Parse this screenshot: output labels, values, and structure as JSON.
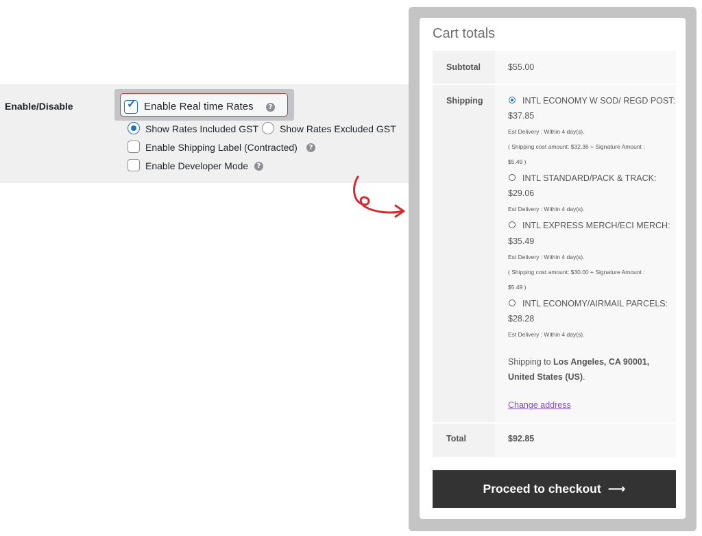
{
  "settings": {
    "section_label": "Enable/Disable",
    "realtime_rates": {
      "label": "Enable Real time Rates",
      "checked": true
    },
    "rates_gst": {
      "included_label": "Show Rates Included GST",
      "excluded_label": "Show Rates Excluded GST",
      "selected": "included"
    },
    "shipping_label": {
      "label": "Enable Shipping Label (Contracted)",
      "checked": false
    },
    "developer_mode": {
      "label": "Enable Developer Mode",
      "checked": false
    },
    "help_glyph": "?"
  },
  "cart": {
    "title": "Cart totals",
    "subtotal_label": "Subtotal",
    "subtotal_value": "$55.00",
    "shipping_label": "Shipping",
    "options": [
      {
        "name": "INTL ECONOMY W SOD/ REGD POST:",
        "price": "$37.85",
        "delivery": "Est Delivery : Within 4 day(s).",
        "cost_line1": "( Shipping cost amount: $32.36 + Signature Amount :",
        "cost_line2": "$5.49 )",
        "selected": true
      },
      {
        "name": "INTL STANDARD/PACK & TRACK:",
        "price": "$29.06",
        "delivery": "Est Delivery : Within 4 day(s).",
        "selected": false
      },
      {
        "name": "INTL EXPRESS MERCH/ECI MERCH:",
        "price": "$35.49",
        "delivery": "Est Delivery : Within 4 day(s).",
        "cost_line1": "( Shipping cost amount: $30.00 + Signature Amount :",
        "cost_line2": "$5.49 )",
        "selected": false
      },
      {
        "name": "INTL ECONOMY/AIRMAIL PARCELS:",
        "price": "$28.28",
        "delivery": "Est Delivery : Within 4 day(s).",
        "selected": false
      }
    ],
    "shipping_to_prefix": "Shipping to",
    "shipping_to_location": "Los Angeles, CA 90001,",
    "shipping_to_country": "United States (US)",
    "shipping_to_suffix": ".",
    "change_address": "Change address",
    "total_label": "Total",
    "total_value": "$92.85",
    "checkout_label": "Proceed to checkout",
    "checkout_arrow": "⟶"
  },
  "colors": {
    "accent": "#2271b1",
    "highlight_border": "#d63638",
    "link": "#7f54b3",
    "button_bg": "#333333",
    "arrow": "#d42a30"
  }
}
